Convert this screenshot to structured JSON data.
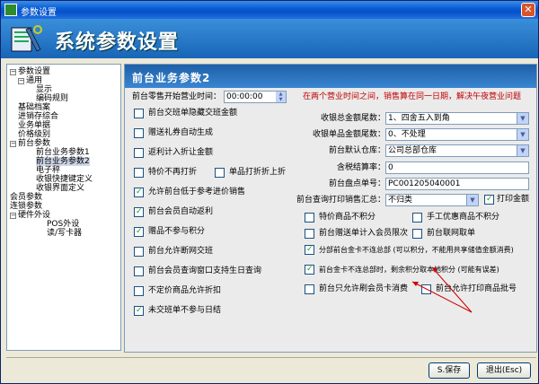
{
  "window": {
    "title": "参数设置",
    "close_glyph": "✕"
  },
  "header": {
    "title": "系统参数设置"
  },
  "tree": {
    "items": [
      {
        "label": "参数设置",
        "toggle": "−"
      },
      {
        "label": "通用",
        "toggle": "−"
      },
      {
        "label": "显示",
        "toggle": ""
      },
      {
        "label": "编码规则",
        "toggle": ""
      },
      {
        "label": "基础档案",
        "toggle": ""
      },
      {
        "label": "进销存综合",
        "toggle": ""
      },
      {
        "label": "业务单据",
        "toggle": ""
      },
      {
        "label": "价格级别",
        "toggle": ""
      },
      {
        "label": "前台参数",
        "toggle": "−"
      },
      {
        "label": "前台业务参数1",
        "toggle": ""
      },
      {
        "label": "前台业务参数2",
        "toggle": ""
      },
      {
        "label": "电子秤",
        "toggle": ""
      },
      {
        "label": "收银快捷键定义",
        "toggle": ""
      },
      {
        "label": "收银界面定义",
        "toggle": ""
      },
      {
        "label": "会员参数",
        "toggle": ""
      },
      {
        "label": "连锁参数",
        "toggle": ""
      },
      {
        "label": "硬件外设",
        "toggle": "−"
      },
      {
        "label": "POS外设",
        "toggle": ""
      },
      {
        "label": "读/写卡器",
        "toggle": ""
      }
    ]
  },
  "panel": {
    "title": "前台业务参数2",
    "note": "在两个营业时间之间，销售算在同一日期，解决午夜营业问题",
    "start_time": {
      "label": "前台零售开始营业时间：",
      "value": "00:00:00"
    },
    "left_options": [
      {
        "label": "前台交班单隐藏交班金额",
        "checked": false
      },
      {
        "label": "赠送礼券自动生成",
        "checked": false
      },
      {
        "label": "返利计入折让金额",
        "checked": false
      },
      {
        "label": "特价不再打折",
        "checked": false
      },
      {
        "label": "允许前台低于参考进价销售",
        "checked": true
      },
      {
        "label": "前台会员自动返利",
        "checked": true
      },
      {
        "label": "赠品不参与积分",
        "checked": true
      },
      {
        "label": "前台允许断网交班",
        "checked": false
      },
      {
        "label": "前台会员查询窗口支持生日查询",
        "checked": false
      },
      {
        "label": "不定价商品允许折扣",
        "checked": false
      },
      {
        "label": "未交班单不参与日结",
        "checked": true
      }
    ],
    "single_discount": {
      "label": "单品打折折上折",
      "checked": false
    },
    "fields": [
      {
        "label": "收银总金额尾数：",
        "value": "1、四舍五入到角",
        "dropdown": true
      },
      {
        "label": "收银单品金额尾数：",
        "value": "0、不处理",
        "dropdown": true
      },
      {
        "label": "前台默认仓库：",
        "value": "公司总部仓库",
        "dropdown": true
      },
      {
        "label": "含税结算率：",
        "value": "0",
        "dropdown": false
      },
      {
        "label": "前台盘点单号：",
        "value": "PC001205040001",
        "dropdown": false
      },
      {
        "label": "前台查询打印销售汇总：",
        "value": "不归类",
        "dropdown": true
      }
    ],
    "print_amount": {
      "label": "打印金额",
      "checked": true
    },
    "right_options": [
      {
        "label": "特价商品不积分",
        "checked": false
      },
      {
        "label": "前台赠送单计入会员限次",
        "checked": false
      },
      {
        "label": "分部前台金卡不连总部 (可以积分，不能用共享储值金额消费)",
        "checked": true
      },
      {
        "label": "前台金卡不连总部时，剩余积分取本地积分 (可能有误差)",
        "checked": true
      },
      {
        "label": "前台只允许刷会员卡消费",
        "checked": false
      }
    ],
    "far_right_options": [
      {
        "label": "手工优惠商品不积分",
        "checked": false
      },
      {
        "label": "前台联网取单",
        "checked": false
      },
      {
        "label": "前台允许打印商品批号",
        "checked": false
      }
    ]
  },
  "buttons": {
    "save": "S.保存",
    "exit": "退出(Esc)"
  },
  "colors": {
    "header_blue": "#1e5fa8",
    "note_red": "#c00000",
    "arrow_red": "#cc0000"
  }
}
